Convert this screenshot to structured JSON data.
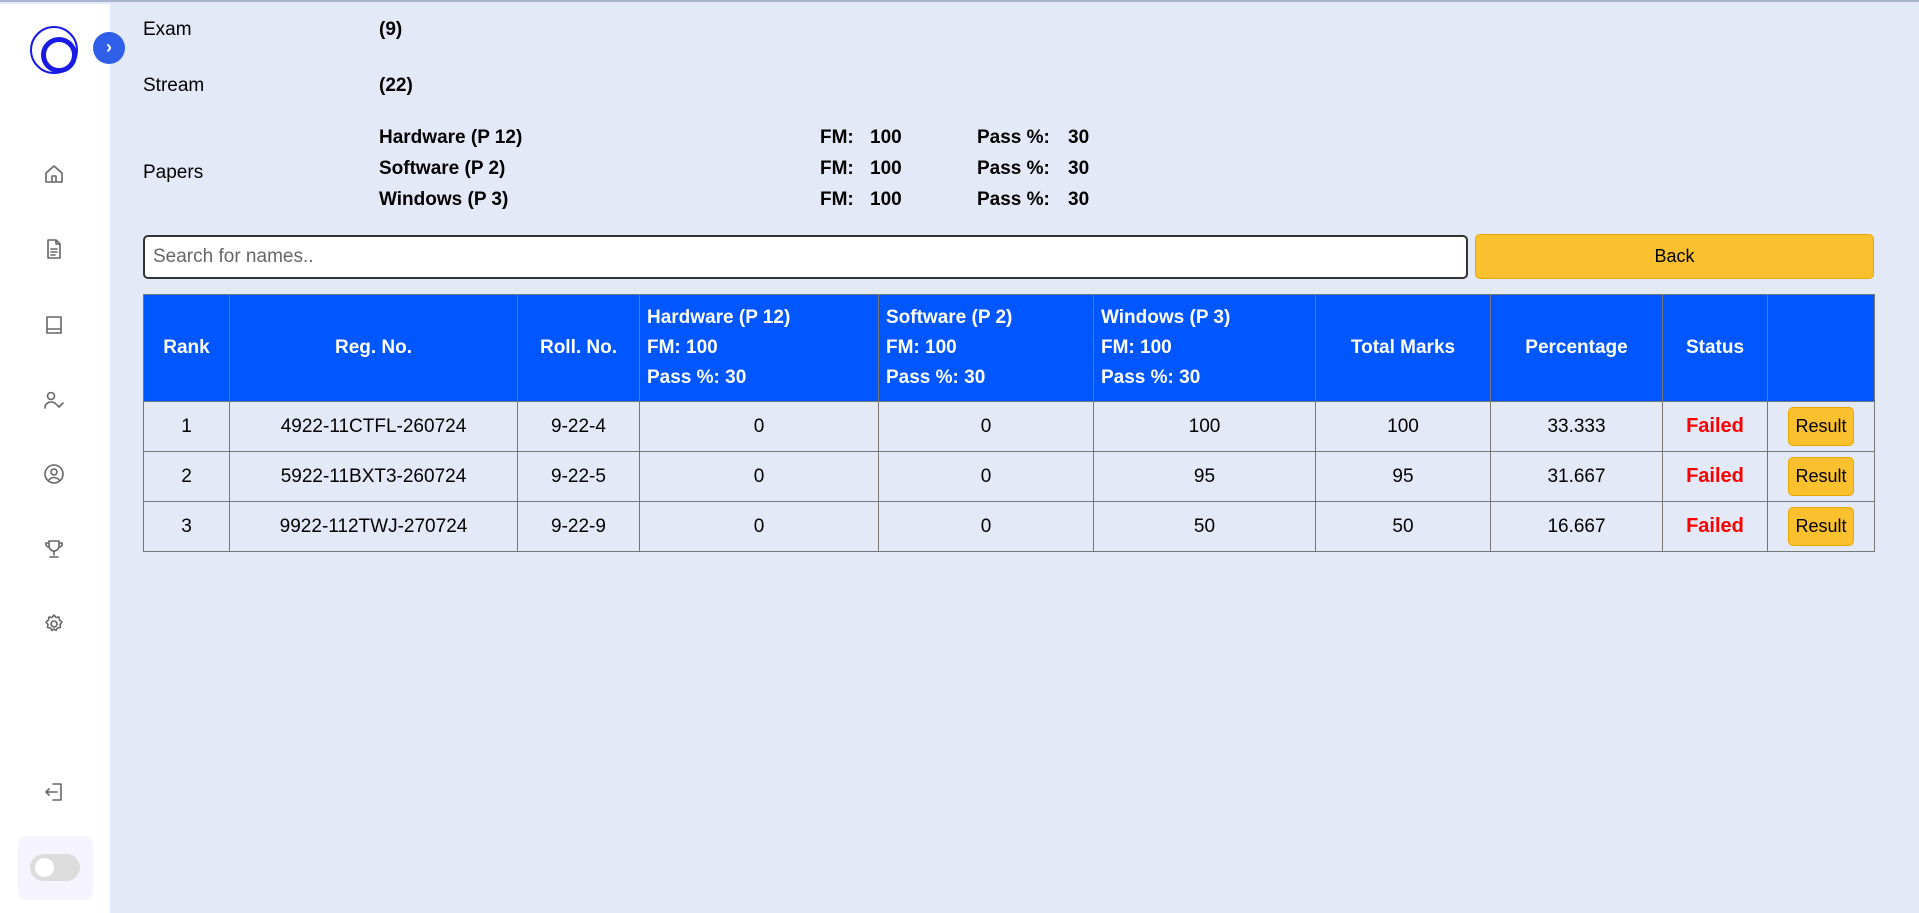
{
  "info": {
    "exam_label": "Exam",
    "exam_value": "(9)",
    "stream_label": "Stream",
    "stream_value": "(22)",
    "papers_label": "Papers",
    "papers": [
      {
        "name": "Hardware  (P 12)",
        "fm_label": "FM:",
        "fm": "100",
        "pass_label": "Pass %:",
        "pass": "30"
      },
      {
        "name": "Software  (P 2)",
        "fm_label": "FM:",
        "fm": "100",
        "pass_label": "Pass %:",
        "pass": "30"
      },
      {
        "name": "Windows  (P 3)",
        "fm_label": "FM:",
        "fm": "100",
        "pass_label": "Pass %:",
        "pass": "30"
      }
    ]
  },
  "search": {
    "placeholder": "Search for names.."
  },
  "back_label": "Back",
  "table": {
    "headers": {
      "rank": "Rank",
      "reg": "Reg. No.",
      "roll": "Roll. No.",
      "total": "Total Marks",
      "percentage": "Percentage",
      "status": "Status"
    },
    "paper_headers": [
      {
        "name": "Hardware  (P 12)",
        "fm": "FM:  100",
        "pass": "Pass %:  30"
      },
      {
        "name": "Software  (P 2)",
        "fm": "FM:  100",
        "pass": "Pass %:  30"
      },
      {
        "name": "Windows  (P 3)",
        "fm": "FM:  100",
        "pass": "Pass %:  30"
      }
    ],
    "rows": [
      {
        "rank": "1",
        "reg": "4922-11CTFL-260724",
        "roll": "9-22-4",
        "p1": "0",
        "p2": "0",
        "p3": "100",
        "total": "100",
        "percentage": "33.333",
        "status": "Failed",
        "action": "Result"
      },
      {
        "rank": "2",
        "reg": "5922-11BXT3-260724",
        "roll": "9-22-5",
        "p1": "0",
        "p2": "0",
        "p3": "95",
        "total": "95",
        "percentage": "31.667",
        "status": "Failed",
        "action": "Result"
      },
      {
        "rank": "3",
        "reg": "9922-112TWJ-270724",
        "roll": "9-22-9",
        "p1": "0",
        "p2": "0",
        "p3": "50",
        "total": "50",
        "percentage": "16.667",
        "status": "Failed",
        "action": "Result"
      }
    ]
  },
  "colors": {
    "header": "#0057ff",
    "accent": "#fbc02d",
    "failed": "#ff0000",
    "background": "#e3e9f7"
  },
  "sidebar": {
    "icons": [
      "home-icon",
      "document-icon",
      "book-icon",
      "user-check-icon",
      "user-circle-icon",
      "trophy-icon",
      "gear-icon",
      "logout-icon"
    ]
  }
}
